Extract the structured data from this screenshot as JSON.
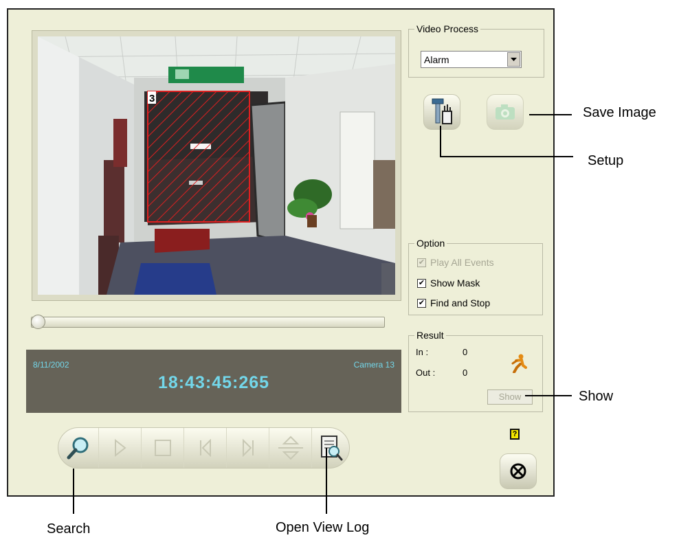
{
  "video": {
    "zone_number": "3"
  },
  "timeline": {
    "date": "8/11/2002",
    "camera": "Camera 13",
    "time": "18:43:45:265"
  },
  "video_process": {
    "legend": "Video Process",
    "selected": "Alarm"
  },
  "option": {
    "legend": "Option",
    "play_all_events": "Play All Events",
    "show_mask": "Show Mask",
    "find_and_stop": "Find and Stop"
  },
  "result": {
    "legend": "Result",
    "in_label": "In  :",
    "in_value": "0",
    "out_label": "Out :",
    "out_value": "0",
    "show_button": "Show"
  },
  "help_glyph": "?",
  "callouts": {
    "save_image": "Save Image",
    "setup": "Setup",
    "show": "Show",
    "search": "Search",
    "open_view_log": "Open View Log"
  },
  "icons": [
    "search-icon",
    "play-icon",
    "stop-icon",
    "previous-icon",
    "next-icon",
    "speed-icon",
    "view-log-icon",
    "setup-icon",
    "camera-icon",
    "running-man-icon",
    "help-icon",
    "close-icon"
  ],
  "colors": {
    "panel_bg": "#eeefd8",
    "time_panel_bg": "#666358",
    "time_text": "#73d7ea",
    "mask_red": "#e02020"
  }
}
